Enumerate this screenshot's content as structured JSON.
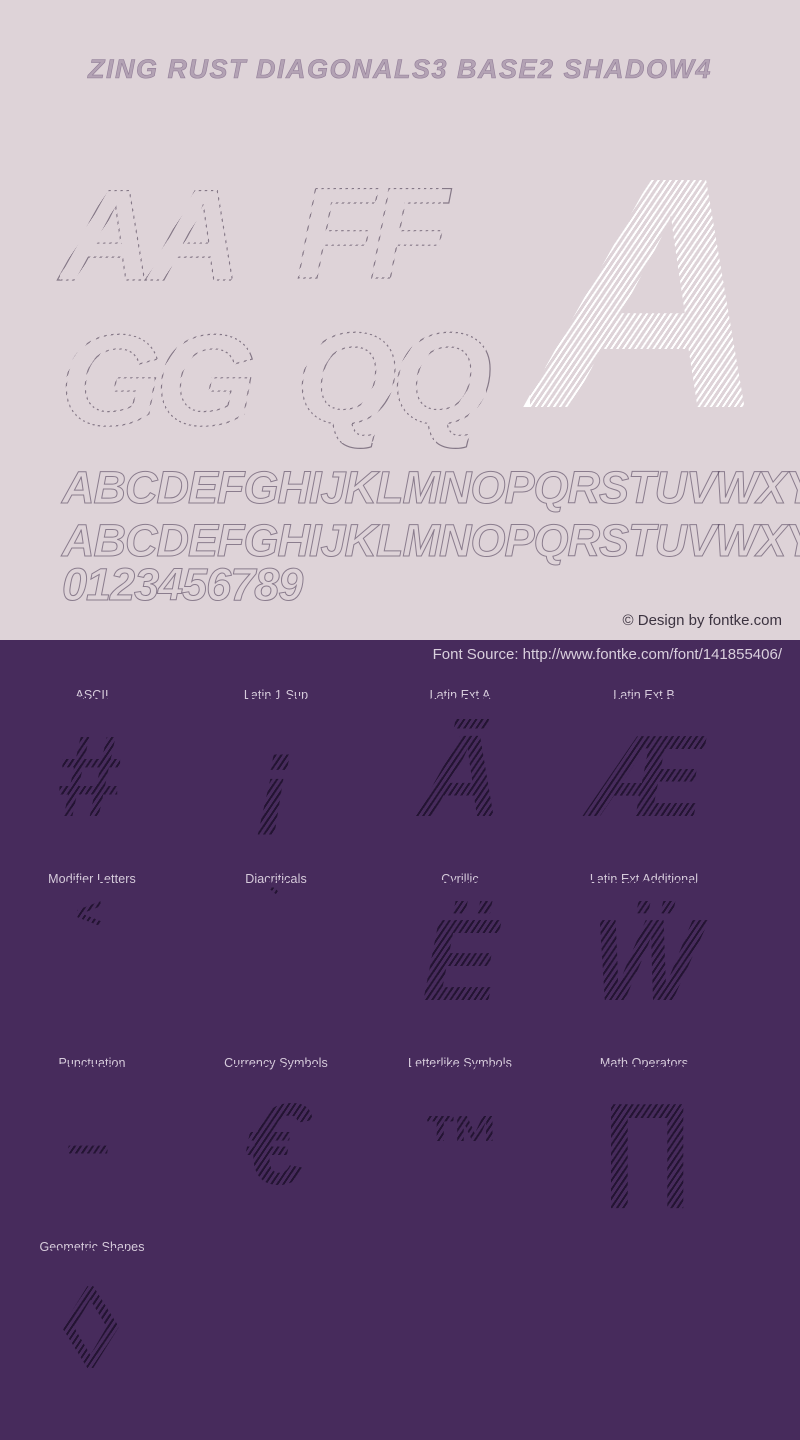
{
  "theme": {
    "light_bg": "#ded3d8",
    "purple_bg": "#472b5c",
    "light_text": "#3c3340",
    "purple_text": "#d6cbdb",
    "glyph_dark": "#241433",
    "glyph_white": "#ffffff"
  },
  "specimen": {
    "title": "Zing Rust Diagonals3 Base2 Shadow4",
    "letter_pairs": [
      {
        "id": "aa",
        "text": "AA"
      },
      {
        "id": "ff",
        "text": "FF"
      },
      {
        "id": "gg",
        "text": "GG"
      },
      {
        "id": "qq",
        "text": "QQ"
      }
    ],
    "hero_glyph": "A",
    "alphabet_upper_1": "ABCDEFGHIJKLMNOPQRSTUVWXYZ",
    "alphabet_upper_2": "ABCDEFGHIJKLMNOPQRSTUVWXYZ",
    "digits": "0123456789",
    "copyright": "© Design by fontke.com"
  },
  "source": {
    "label": "Font Source: http://www.fontke.com/font/141855406/"
  },
  "ranges": {
    "rows": [
      {
        "cells": [
          {
            "label": "ASCII",
            "sample": "#",
            "size": "normal"
          },
          {
            "label": "Latin 1 Sup",
            "sample": "¡",
            "size": "normal"
          },
          {
            "label": "Latin Ext A",
            "sample": "Ā",
            "size": "normal"
          },
          {
            "label": "Latin Ext B",
            "sample": "Æ",
            "size": "normal"
          }
        ]
      },
      {
        "cells": [
          {
            "label": "Modifier Letters",
            "sample": "˂",
            "size": "small"
          },
          {
            "label": "Diacriticals",
            "sample": "̀",
            "size": "small"
          },
          {
            "label": "Cyrillic",
            "sample": "Ё",
            "size": "normal"
          },
          {
            "label": "Latin Ext Additional",
            "sample": "Ẅ",
            "size": "normal"
          }
        ]
      },
      {
        "cells": [
          {
            "label": "Punctuation",
            "sample": "–",
            "size": "medium"
          },
          {
            "label": "Currency Symbols",
            "sample": "€",
            "size": "normal"
          },
          {
            "label": "Letterlike Symbols",
            "sample": "™",
            "size": "medium"
          },
          {
            "label": "Math Operators",
            "sample": "∏",
            "size": "normal"
          }
        ]
      },
      {
        "cells": [
          {
            "label": "Geometric Shapes",
            "sample": "◊",
            "size": "normal"
          }
        ]
      }
    ]
  }
}
